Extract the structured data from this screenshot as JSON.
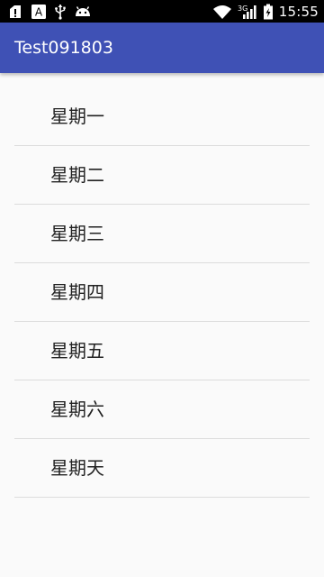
{
  "status_bar": {
    "time": "15:55",
    "network_label": "3G",
    "keyboard_letter": "A",
    "icons": [
      "alert-download-icon",
      "keyboard-a-icon",
      "usb-icon",
      "android-icon",
      "wifi-icon",
      "cell-signal-icon",
      "battery-icon"
    ]
  },
  "app_bar": {
    "title": "Test091803",
    "color": "#3f51b5"
  },
  "list": {
    "items": [
      {
        "label": "星期一"
      },
      {
        "label": "星期二"
      },
      {
        "label": "星期三"
      },
      {
        "label": "星期四"
      },
      {
        "label": "星期五"
      },
      {
        "label": "星期六"
      },
      {
        "label": "星期天"
      }
    ]
  }
}
